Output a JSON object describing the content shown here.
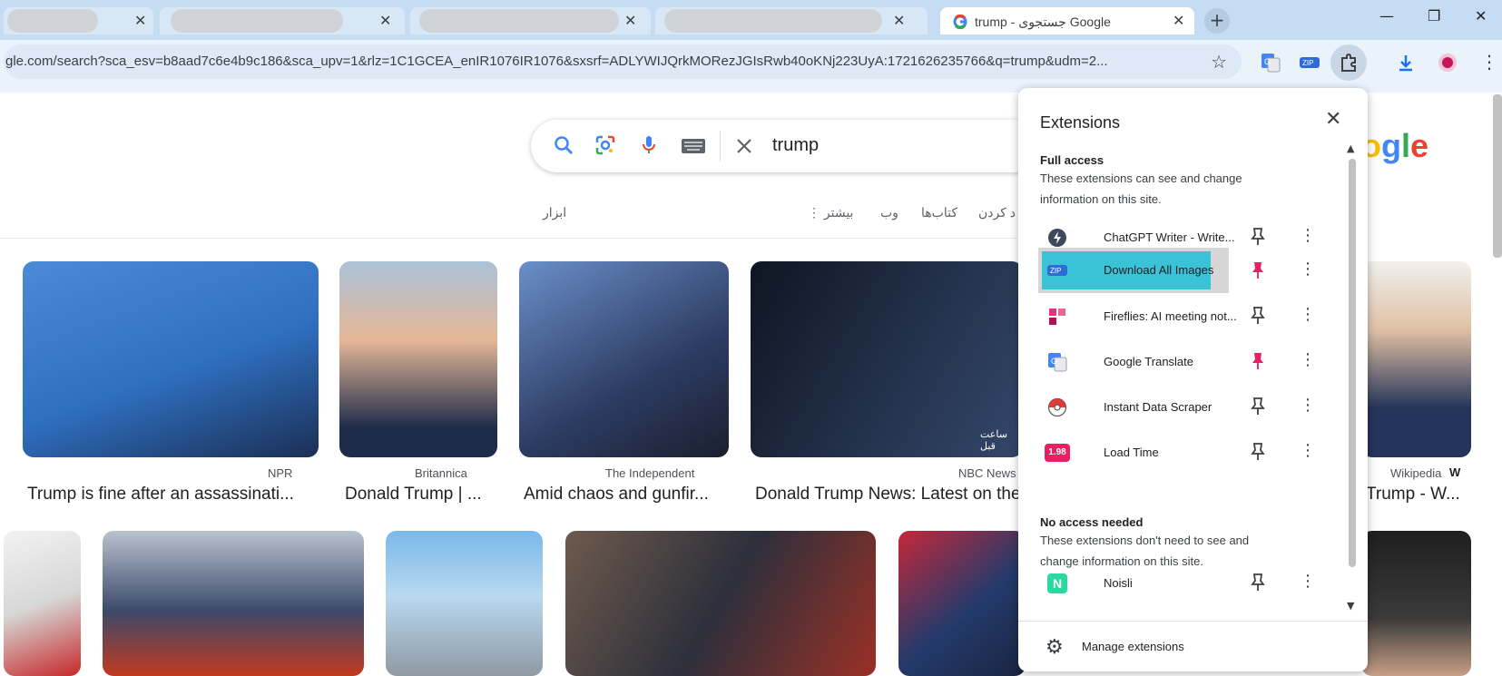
{
  "browser": {
    "tabs": [
      {
        "label": "",
        "state": "blurred"
      },
      {
        "label": "",
        "state": "blurred"
      },
      {
        "label": "",
        "state": "blurred"
      },
      {
        "label": "",
        "state": "blurred"
      },
      {
        "label": "trump - جستجوی Google",
        "state": "active"
      }
    ],
    "new_tab_label": "+",
    "url": "gle.com/search?sca_esv=b8aad7c6e4b9c186&sca_upv=1&rlz=1C1GCEA_enIR1076IR1076&sxsrf=ADLYWIJQrkMORezJGIsRwb40oKNj223UyA:1721626235766&q=trump&udm=2...",
    "window_controls": [
      "—",
      "❐",
      "✕"
    ]
  },
  "search": {
    "query": "trump",
    "nav_tools": "ابزار",
    "nav_more": "بیشتر",
    "nav_web": "وب",
    "nav_books": "کتاب‌ها",
    "nav_partial": "د کردن",
    "logo_partial": "ogle"
  },
  "results_row1": [
    {
      "source": "NPR",
      "caption": "Trump is fine after an assassinati...",
      "bg": "#3d7bc7"
    },
    {
      "source": "Britannica",
      "caption": "Donald Trump | ...",
      "bg": "#9fb6cf"
    },
    {
      "source": "The Independent",
      "caption": "Amid chaos and gunfir...",
      "bg": "#40557e"
    },
    {
      "source": "NBC News",
      "caption": "Donald Trump News: Latest on the",
      "bg": "#1d2a44",
      "overlay": "ساعت قبل"
    },
    {
      "source": "Wikipedia",
      "caption": "Trump - W...",
      "bg": "#3f5c93"
    }
  ],
  "results_row2": [
    {
      "bg": "#e7e7e7"
    },
    {
      "bg": "#7d8aa3"
    },
    {
      "bg": "#8cc3ec"
    },
    {
      "bg": "#5a4a42"
    },
    {
      "bg": "#2f4d82"
    },
    {
      "bg": "#2b2b2b"
    }
  ],
  "extensions_popup": {
    "title": "Extensions",
    "full_access_heading": "Full access",
    "full_access_desc": "These extensions can see and change information on this site.",
    "full_access": [
      {
        "name": "ChatGPT Writer - Write...",
        "icon": "chatgpt-writer-icon",
        "icon_color": "#3d4a5c",
        "pinned": false
      },
      {
        "name": "Download All Images",
        "icon": "zip-icon",
        "icon_color": "#2f6bd8",
        "pinned": true,
        "highlighted": true
      },
      {
        "name": "Fireflies: AI meeting not...",
        "icon": "fireflies-icon",
        "icon_color": "#e2357a",
        "pinned": false
      },
      {
        "name": "Google Translate",
        "icon": "google-translate-icon",
        "icon_color": "#4285f4",
        "pinned": true
      },
      {
        "name": "Instant Data Scraper",
        "icon": "pokeball-icon",
        "icon_color": "#e53935",
        "pinned": false
      },
      {
        "name": "Load Time",
        "icon": "load-time-icon",
        "icon_color": "#e91e63",
        "icon_text": "1.98",
        "pinned": false
      }
    ],
    "no_access_heading": "No access needed",
    "no_access_desc": "These extensions don't need to see and change information on this site.",
    "no_access": [
      {
        "name": "Noisli",
        "icon": "noisli-icon",
        "icon_color": "#2bd9a0",
        "icon_text": "N",
        "pinned": false
      }
    ],
    "manage_label": "Manage extensions"
  },
  "colors": {
    "pinned": "#e91e63",
    "unpinned": "#3c4043",
    "highlight": "#3ac2d6"
  }
}
